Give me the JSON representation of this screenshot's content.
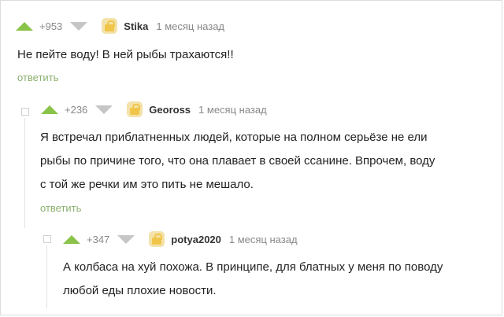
{
  "comments": [
    {
      "rating": "+953",
      "author": "Stika",
      "time": "1 месяц назад",
      "text_lines": [
        "Не пейте воду! В ней рыбы трахаются!!"
      ],
      "reply": "ответить"
    },
    {
      "rating": "+236",
      "author": "Geoross",
      "time": "1 месяц назад",
      "text_lines": [
        "Я встречал приблатненных людей, которые на полном серьёзе не ели",
        "рыбы по причине того, что она плавает в своей ссанине. Впрочем, воду",
        "с той же речки им это пить не мешало."
      ],
      "reply": "ответить"
    },
    {
      "rating": "+347",
      "author": "potya2020",
      "time": "1 месяц назад",
      "text_lines": [
        "А колбаса на хуй похожа. В принципе, для блатных у меня по поводу",
        "любой еды плохие новости."
      ]
    }
  ],
  "colors": {
    "upvote": "#8bc34a",
    "downvote": "#c6c6c6",
    "reply": "#8bb06e"
  }
}
